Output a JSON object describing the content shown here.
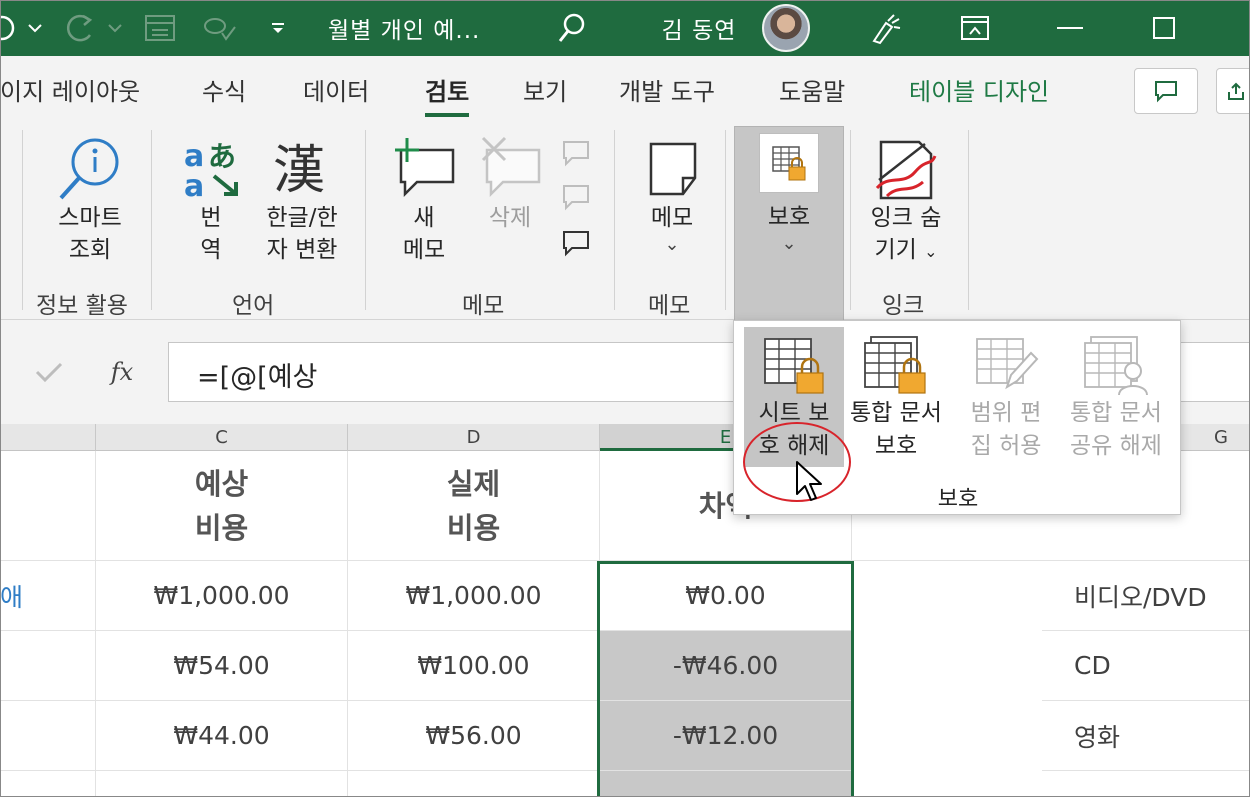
{
  "titlebar": {
    "title": "월별 개인 예...",
    "user": "김 동연",
    "bg": "#1f6b3f"
  },
  "tabs": [
    {
      "label": "이지 레이아웃"
    },
    {
      "label": "수식"
    },
    {
      "label": "데이터"
    },
    {
      "label": "검토",
      "active": true
    },
    {
      "label": "보기"
    },
    {
      "label": "개발 도구"
    },
    {
      "label": "도움말"
    },
    {
      "label": "테이블 디자인",
      "color": "#1f7a45"
    }
  ],
  "ribbon": {
    "insights": {
      "smart_lookup": [
        "스마트",
        "조회"
      ],
      "group": "정보 활용"
    },
    "language": {
      "translate": [
        "번",
        "역"
      ],
      "hanja": [
        "한글/한",
        "자 변환"
      ],
      "group": "언어"
    },
    "memo": {
      "new": [
        "새",
        "메모"
      ],
      "delete": "삭제",
      "group": "메모"
    },
    "notes": {
      "note": "메모",
      "group": "메모"
    },
    "protect": {
      "label": "보호"
    },
    "ink": {
      "hide": [
        "잉크 숨",
        "기기"
      ],
      "group": "잉크"
    }
  },
  "formula": {
    "text": "=[@[예상",
    "fx": "fx"
  },
  "columns": [
    "C",
    "D",
    "E",
    "G"
  ],
  "table": {
    "header_c": [
      "예상",
      "비용"
    ],
    "header_d": [
      "실제",
      "비용"
    ],
    "header_e": "차액",
    "col_b_partial": "애",
    "rows": [
      {
        "c": "₩1,000.00",
        "d": "₩1,000.00",
        "e": "₩0.00",
        "g": "비디오/DVD"
      },
      {
        "c": "₩54.00",
        "d": "₩100.00",
        "e": "-₩46.00",
        "g": "CD"
      },
      {
        "c": "₩44.00",
        "d": "₩56.00",
        "e": "-₩12.00",
        "g": "영화"
      }
    ]
  },
  "dropdown": {
    "items": [
      {
        "label": [
          "시트 보",
          "호 해제"
        ],
        "enabled": true,
        "hover": true
      },
      {
        "label": [
          "통합 문서",
          "보호"
        ],
        "enabled": true
      },
      {
        "label": [
          "범위 편",
          "집 허용"
        ],
        "enabled": false
      },
      {
        "label": [
          "통합 문서",
          "공유 해제"
        ],
        "enabled": false
      }
    ],
    "group": "보호"
  },
  "colors": {
    "accent": "#1f6b3f",
    "highlight_circle": "#d8242b",
    "lock": "#f0a830"
  }
}
